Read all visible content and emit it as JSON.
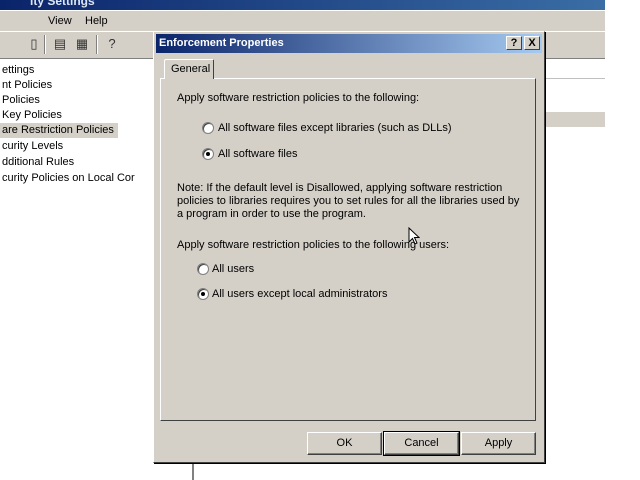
{
  "app": {
    "title": "ity Settings",
    "menu": [
      "View",
      "Help"
    ]
  },
  "tree": {
    "items": [
      "ettings",
      "nt Policies",
      "Policies",
      "Key Policies",
      "are Restriction Policies",
      "curity Levels",
      "dditional Rules",
      "curity Policies on Local Cor"
    ],
    "selected_index": 4
  },
  "dialog": {
    "title": "Enforcement Properties",
    "help_label": "?",
    "close_label": "X",
    "tab_label": "General",
    "section1_label": "Apply software restriction policies to the following:",
    "option_files_except_libs": "All software files except libraries (such as DLLs)",
    "option_all_files": "All software files",
    "note": "Note:  If the default level is Disallowed, applying software restriction policies to libraries requires you to set rules for all the libraries used by a program in order to use the program.",
    "section2_label": "Apply software restriction policies to the following users:",
    "option_all_users": "All users",
    "option_except_admins": "All users except local administrators",
    "ok_label": "OK",
    "cancel_label": "Cancel",
    "apply_label": "Apply"
  }
}
